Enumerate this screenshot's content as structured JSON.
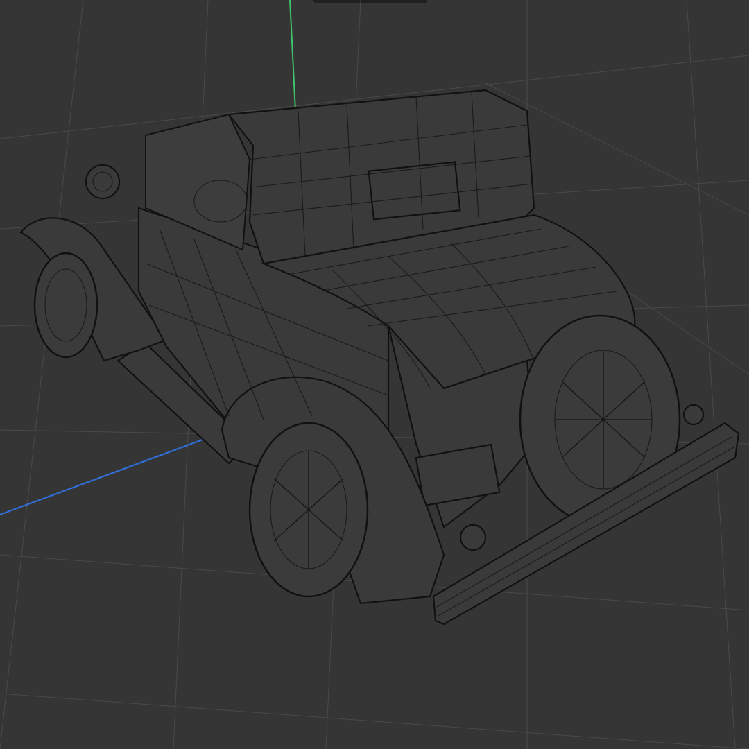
{
  "viewport": {
    "background": "#353535",
    "grid_color": "#4a4a4a",
    "axis_colors": {
      "y": "#3fc36b",
      "z": "#2f6fd8"
    },
    "object": "wireframe-vintage-roadster",
    "shading": "wireframe"
  },
  "icons": [
    "y-axis-line",
    "z-axis-line"
  ]
}
